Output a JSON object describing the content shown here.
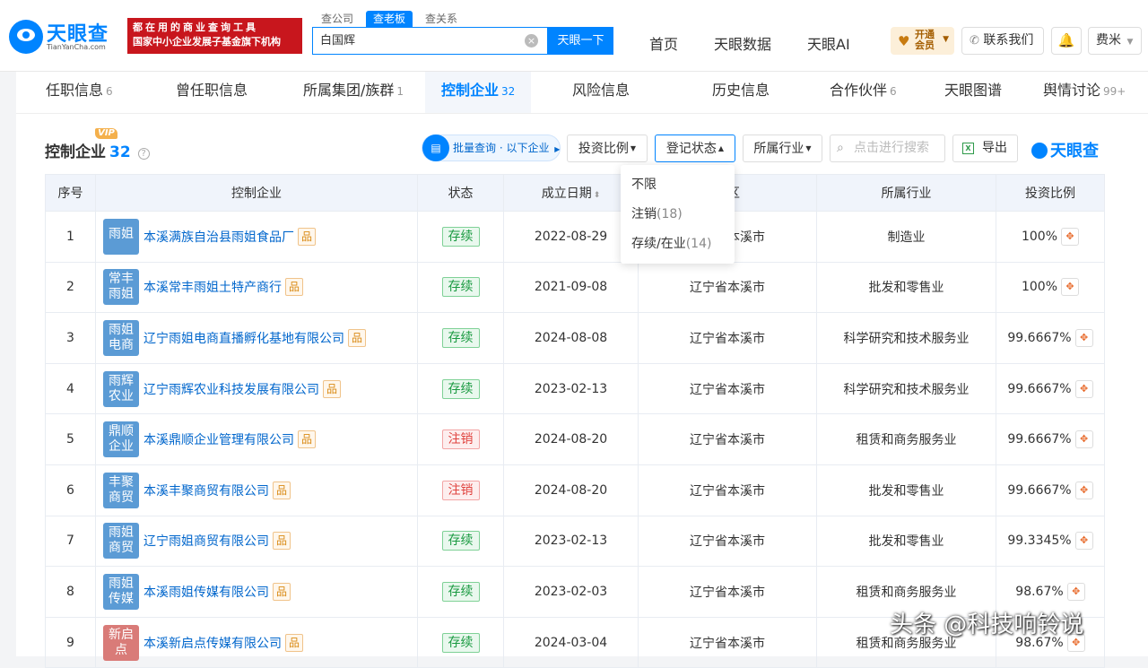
{
  "brand": {
    "name": "天眼查",
    "domain": "TianYanCha.com",
    "ad_line1": "都在用的商业查询工具",
    "ad_line2": "国家中小企业发展子基金旗下机构",
    "mark": "天眼查"
  },
  "search": {
    "tabs": [
      "查公司",
      "查老板",
      "查关系"
    ],
    "active_tab": 1,
    "value": "白国辉",
    "button": "天眼一下"
  },
  "top_nav": [
    "首页",
    "天眼数据",
    "天眼AI"
  ],
  "vip_button": {
    "line1": "开通",
    "line2": "会员"
  },
  "contact_button": "联系我们",
  "user_button": "费米",
  "sub_tabs": [
    {
      "label": "任职信息",
      "count": "6"
    },
    {
      "label": "曾任职信息",
      "count": ""
    },
    {
      "label": "所属集团/族群",
      "count": "1"
    },
    {
      "label": "控制企业",
      "count": "32"
    },
    {
      "label": "风险信息",
      "count": ""
    },
    {
      "label": "历史信息",
      "count": ""
    },
    {
      "label": "合作伙伴",
      "count": "6"
    },
    {
      "label": "天眼图谱",
      "count": ""
    },
    {
      "label": "舆情讨论",
      "count": "99+"
    }
  ],
  "panel": {
    "title": "控制企业",
    "count": "32",
    "vip_tag": "VIP",
    "batch_label": "批量查询 · 以下企业",
    "filters": [
      "投资比例",
      "登记状态",
      "所属行业"
    ],
    "search_placeholder": "点击进行搜索",
    "export_label": "导出"
  },
  "table": {
    "headers": [
      "序号",
      "控制企业",
      "状态",
      "成立日期",
      "地区",
      "所属行业",
      "投资比例"
    ],
    "rows": [
      {
        "no": "1",
        "logo": "雨姐",
        "name": "本溪满族自治县雨姐食品厂",
        "status": "存续",
        "date": "2022-08-29",
        "region": "辽宁省本溪市",
        "industry": "制造业",
        "ratio": "100%"
      },
      {
        "no": "2",
        "logo": "常丰雨姐",
        "name": "本溪常丰雨姐土特产商行",
        "status": "存续",
        "date": "2021-09-08",
        "region": "辽宁省本溪市",
        "industry": "批发和零售业",
        "ratio": "100%"
      },
      {
        "no": "3",
        "logo": "雨姐电商",
        "name": "辽宁雨姐电商直播孵化基地有限公司",
        "status": "存续",
        "date": "2024-08-08",
        "region": "辽宁省本溪市",
        "industry": "科学研究和技术服务业",
        "ratio": "99.6667%"
      },
      {
        "no": "4",
        "logo": "雨辉农业",
        "name": "辽宁雨辉农业科技发展有限公司",
        "status": "存续",
        "date": "2023-02-13",
        "region": "辽宁省本溪市",
        "industry": "科学研究和技术服务业",
        "ratio": "99.6667%"
      },
      {
        "no": "5",
        "logo": "鼎顺企业",
        "name": "本溪鼎顺企业管理有限公司",
        "status": "注销",
        "date": "2024-08-20",
        "region": "辽宁省本溪市",
        "industry": "租赁和商务服务业",
        "ratio": "99.6667%"
      },
      {
        "no": "6",
        "logo": "丰聚商贸",
        "name": "本溪丰聚商贸有限公司",
        "status": "注销",
        "date": "2024-08-20",
        "region": "辽宁省本溪市",
        "industry": "批发和零售业",
        "ratio": "99.6667%"
      },
      {
        "no": "7",
        "logo": "雨姐商贸",
        "name": "辽宁雨姐商贸有限公司",
        "status": "存续",
        "date": "2023-02-13",
        "region": "辽宁省本溪市",
        "industry": "批发和零售业",
        "ratio": "99.3345%"
      },
      {
        "no": "8",
        "logo": "雨姐传媒",
        "name": "本溪雨姐传媒有限公司",
        "status": "存续",
        "date": "2023-02-03",
        "region": "辽宁省本溪市",
        "industry": "租赁和商务服务业",
        "ratio": "98.67%"
      },
      {
        "no": "9",
        "logo": "新启点",
        "name": "本溪新启点传媒有限公司",
        "status": "存续",
        "date": "2024-03-04",
        "region": "辽宁省本溪市",
        "industry": "租赁和商务服务业",
        "ratio": "98.67%"
      }
    ]
  },
  "dropdown": [
    {
      "label": "不限",
      "count": ""
    },
    {
      "label": "注销",
      "count": "(18)"
    },
    {
      "label": "存续/在业",
      "count": "(14)"
    }
  ],
  "watermark": "头条 @科技响铃说",
  "colors": {
    "primary": "#0084ff",
    "banner_red": "#c8161d",
    "status_active": "#1a9a41",
    "status_cancelled": "#e0433f",
    "logo_blue": "#5b9bd5",
    "logo_red": "#d97b78"
  }
}
